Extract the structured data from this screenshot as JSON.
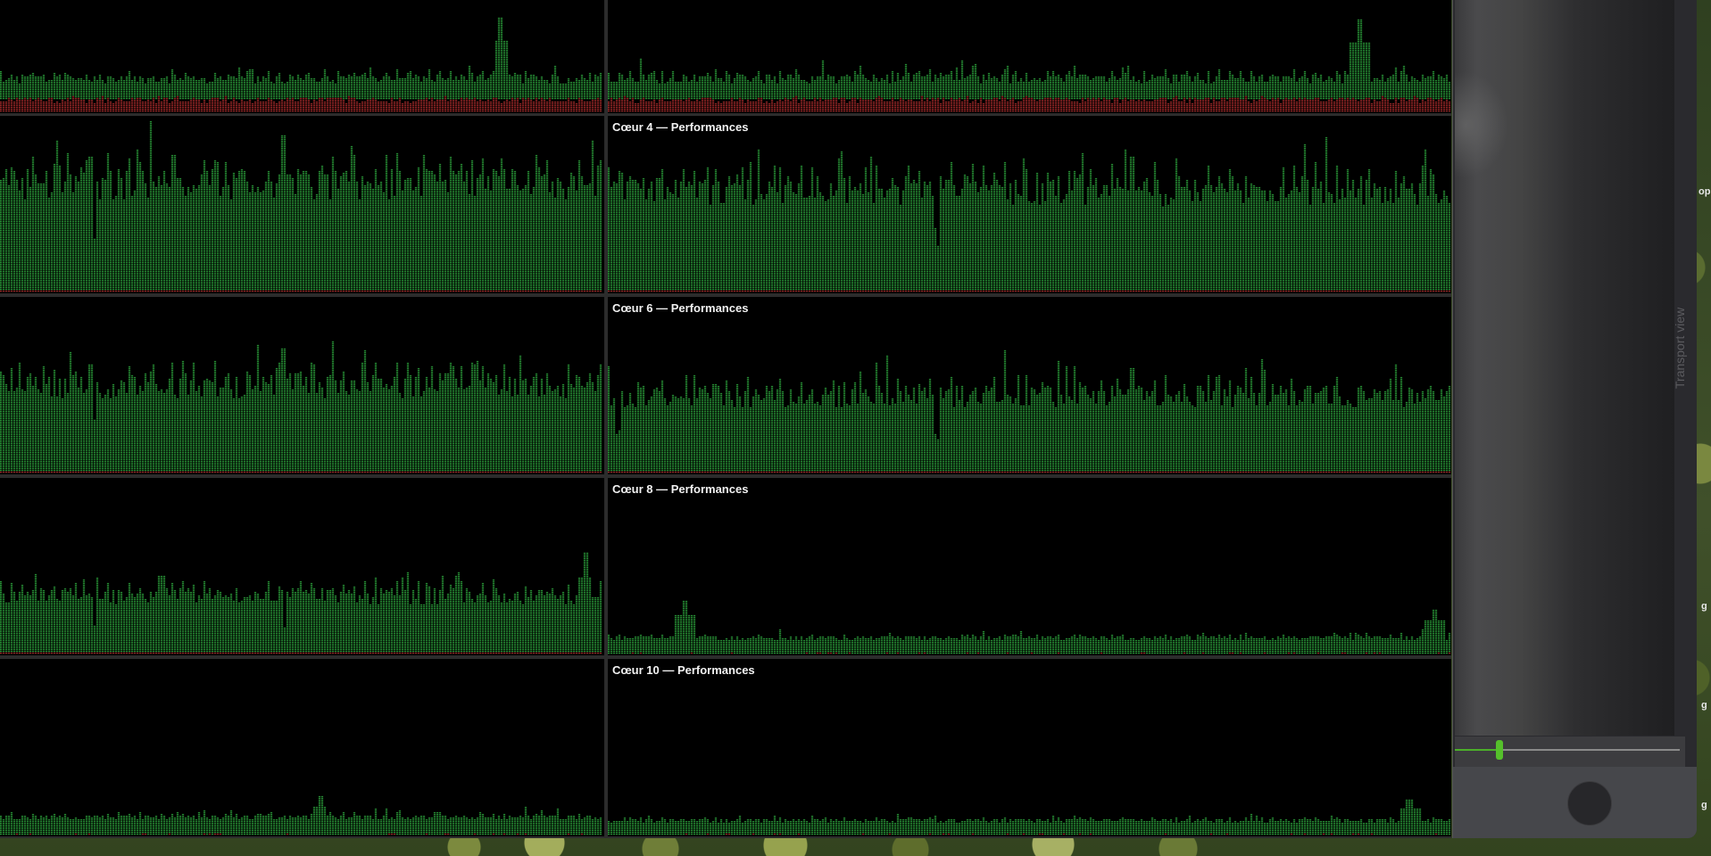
{
  "cpu_window": {
    "cells": [
      {
        "title": "",
        "profile": "upper",
        "seed": 11,
        "avg": 0.3,
        "spikes": [
          [
            0.83,
            0.86
          ]
        ],
        "red": 0.11
      },
      {
        "title": "",
        "profile": "upper",
        "seed": 12,
        "avg": 0.3,
        "spikes": [
          [
            0.89,
            0.84
          ]
        ],
        "red": 0.11
      },
      {
        "title": "",
        "profile": "high",
        "seed": 21,
        "avg": 0.62,
        "spikes": [
          [
            0.47,
            0.9
          ],
          [
            0.15,
            0.78
          ]
        ],
        "dips": [
          0.155
        ],
        "red": 0.01
      },
      {
        "title": "Cœur 4 — Performances",
        "profile": "high",
        "seed": 22,
        "avg": 0.58,
        "spikes": [
          [
            0.62,
            0.78
          ]
        ],
        "dips": [
          0.39
        ],
        "red": 0.01
      },
      {
        "title": "",
        "profile": "high",
        "seed": 31,
        "avg": 0.5,
        "spikes": [
          [
            0.47,
            0.72
          ],
          [
            0.15,
            0.62
          ],
          [
            0.79,
            0.62
          ]
        ],
        "dips": [
          0.155
        ],
        "red": 0.01
      },
      {
        "title": "Cœur 6 — Performances",
        "profile": "high",
        "seed": 32,
        "avg": 0.44,
        "spikes": [
          [
            0.62,
            0.6
          ]
        ],
        "dips": [
          0.39,
          0.01
        ],
        "red": 0.01
      },
      {
        "title": "",
        "profile": "high",
        "seed": 41,
        "avg": 0.33,
        "spikes": [
          [
            0.97,
            0.58
          ],
          [
            0.27,
            0.45
          ]
        ],
        "dips": [
          0.155,
          0.47
        ],
        "red": 0.01
      },
      {
        "title": "Cœur 8 — Performances",
        "profile": "low",
        "seed": 42,
        "avg": 0.09,
        "spikes": [
          [
            0.09,
            0.3
          ],
          [
            0.98,
            0.25
          ]
        ],
        "red": 0.0
      },
      {
        "title": "",
        "profile": "low",
        "seed": 51,
        "avg": 0.1,
        "spikes": [
          [
            0.53,
            0.22
          ]
        ],
        "red": 0.0
      },
      {
        "title": "Cœur 10 — Performances",
        "profile": "low",
        "seed": 52,
        "avg": 0.08,
        "spikes": [
          [
            0.95,
            0.2
          ]
        ],
        "red": 0.0
      }
    ],
    "colors": {
      "user": "#3ad44f",
      "system": "#e03b3b",
      "background": "#000000"
    }
  },
  "side_panel": {
    "transport_label": "Transport view",
    "slider_value": 0.2,
    "slider_color": "#55c02b"
  },
  "edge_fragments": [
    "op",
    "g",
    "g",
    "g"
  ]
}
